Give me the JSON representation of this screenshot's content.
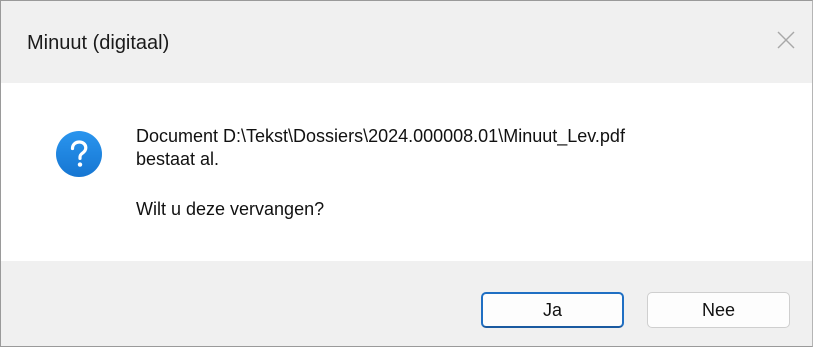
{
  "window": {
    "title": "Minuut (digitaal)",
    "close_icon": "close-icon"
  },
  "message": {
    "icon": "question-icon",
    "line1": "Document D:\\Tekst\\Dossiers\\2024.000008.01\\Minuut_Lev.pdf",
    "line2": "bestaat al.",
    "line3": "Wilt u deze vervangen?"
  },
  "buttons": {
    "yes_label": "Ja",
    "no_label": "Nee"
  },
  "colors": {
    "icon_blue": "#1e88e5",
    "default_button_border": "#1f6fc3",
    "chrome_background": "#f0f0f0"
  }
}
